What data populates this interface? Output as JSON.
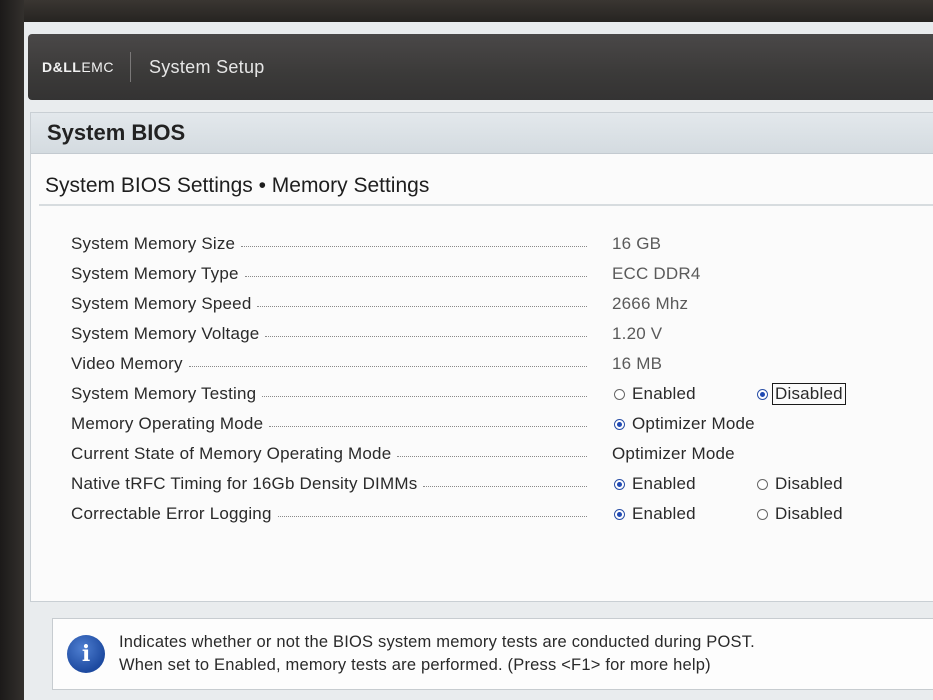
{
  "header": {
    "brand_dell": "D&LL",
    "brand_emc": "EMC",
    "title": "System Setup"
  },
  "panel": {
    "title": "System BIOS",
    "section_title": "System BIOS Settings • Memory Settings"
  },
  "settings": {
    "system_memory_size": {
      "label": "System Memory Size",
      "value": "16 GB"
    },
    "system_memory_type": {
      "label": "System Memory Type",
      "value": "ECC DDR4"
    },
    "system_memory_speed": {
      "label": "System Memory Speed",
      "value": "2666 Mhz"
    },
    "system_memory_voltage": {
      "label": "System Memory Voltage",
      "value": "1.20 V"
    },
    "video_memory": {
      "label": "Video Memory",
      "value": "16 MB"
    },
    "system_memory_testing": {
      "label": "System Memory Testing",
      "option_1": "Enabled",
      "option_2": "Disabled",
      "selected": "Disabled"
    },
    "memory_operating_mode": {
      "label": "Memory Operating Mode",
      "option_1": "Optimizer Mode",
      "selected": "Optimizer Mode"
    },
    "current_state_memory_operating_mode": {
      "label": "Current State of Memory Operating Mode",
      "value": "Optimizer Mode"
    },
    "native_trfc_timing": {
      "label": "Native tRFC Timing for 16Gb Density DIMMs",
      "option_1": "Enabled",
      "option_2": "Disabled",
      "selected": "Enabled"
    },
    "correctable_error_logging": {
      "label": "Correctable Error Logging",
      "option_1": "Enabled",
      "option_2": "Disabled",
      "selected": "Enabled"
    }
  },
  "help": {
    "line_1": "Indicates whether or not the BIOS system memory tests are conducted during POST.",
    "line_2": "When set to Enabled, memory tests are performed. (Press <F1> for more help)"
  },
  "icons": {
    "info": "info-icon"
  },
  "colors": {
    "header_bg": "#3b3a39",
    "panel_bg": "#fbfbfb",
    "titlebar_bg": "#d9dfe3",
    "radio_selected": "#1f49b3",
    "info_icon": "#1d4aa0"
  }
}
